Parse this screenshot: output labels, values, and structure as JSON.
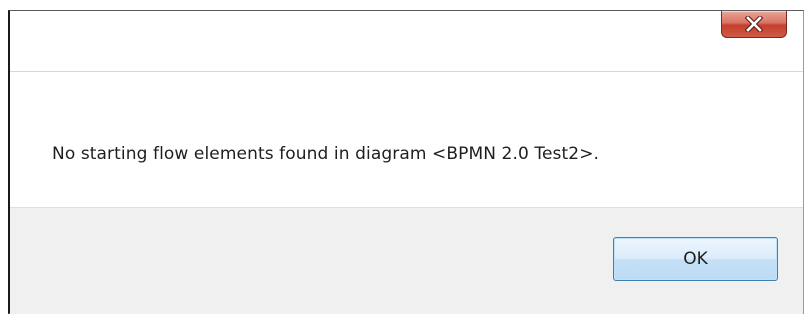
{
  "dialog": {
    "close_icon": "close-x-icon",
    "message": "No starting flow elements found in diagram <BPMN 2.0 Test2>.",
    "ok_label": "OK"
  },
  "colors": {
    "close_button": "#c7432f",
    "ok_border": "#3c7fb1",
    "footer_bg": "#f0f0f0"
  }
}
